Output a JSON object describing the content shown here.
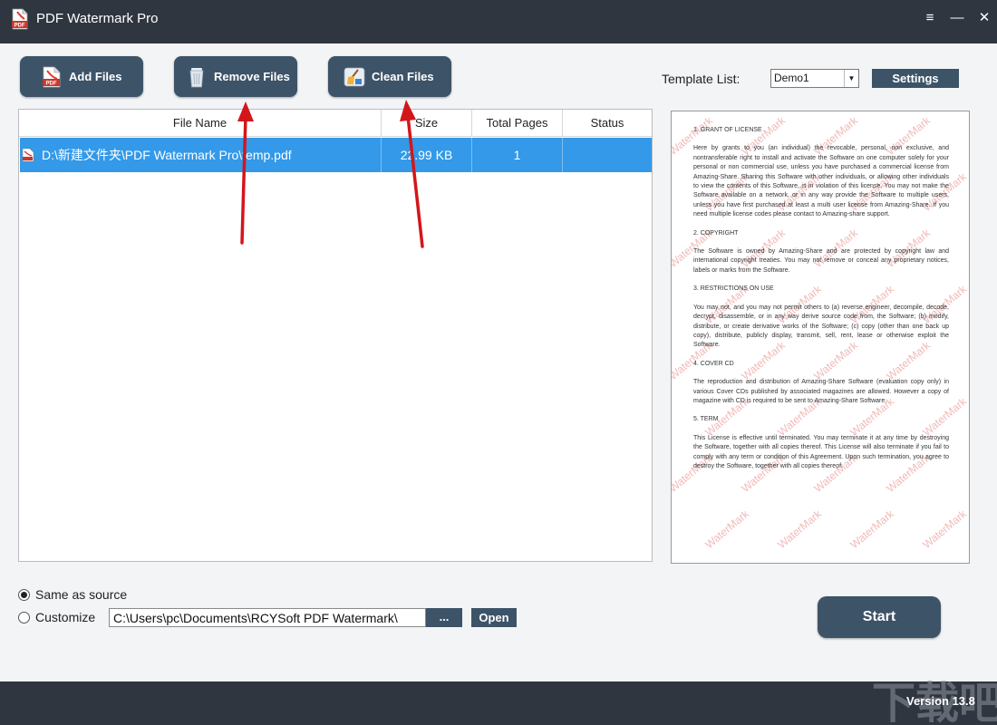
{
  "window": {
    "title": "PDF Watermark Pro",
    "app_icon_text": "PDF",
    "controls": {
      "menu": "≡",
      "minimize": "—",
      "close": "✕"
    }
  },
  "toolbar": {
    "add_files": "Add Files",
    "remove_files": "Remove Files",
    "clean_files": "Clean Files",
    "add_icon_text": "PDF"
  },
  "template": {
    "label": "Template List:",
    "selected": "Demo1",
    "settings_label": "Settings"
  },
  "table": {
    "columns": [
      "File Name",
      "Size",
      "Total Pages",
      "Status"
    ],
    "rows": [
      {
        "file_name": "D:\\新建文件夹\\PDF Watermark Pro\\temp.pdf",
        "size": "22.99 KB",
        "total_pages": "1",
        "status": ""
      }
    ]
  },
  "preview": {
    "watermark_text": "WaterMark",
    "sections": [
      {
        "heading": "1. GRANT OF LICENSE",
        "body": "Here by grants to you (an individual) the revocable, personal, non exclusive, and nontransferable right to install and activate the Software on one computer solely for your personal or non commercial use, unless you have purchased a commercial license from Amazing-Share. Sharing this Software with other individuals, or allowing other individuals to view the contents of this Software, is in violation of this license. You may not make the Software available on a network, or in any way provide the Software to multiple users, unless you have first purchased at least a multi user license from Amazing-Share. If you need multiple license codes please contact to Amazing-share support."
      },
      {
        "heading": "2. COPYRIGHT",
        "body": "The Software is owned by Amazing-Share and are protected by copyright law and international copyright treaties. You may not remove or conceal any proprietary notices, labels or marks from the Software."
      },
      {
        "heading": "3. RESTRICTIONS ON USE",
        "body": "You may not, and you may not permit others to (a) reverse engineer, decompile, decode, decrypt, disassemble, or in any way derive source code from, the Software; (b) modify, distribute, or create derivative works of the Software; (c) copy (other than one back up copy), distribute, publicly display, transmit, sell, rent, lease or otherwise exploit the Software."
      },
      {
        "heading": "4. COVER CD",
        "body": "The reproduction and distribution of Amazing-Share Software (evaluation copy only) in various Cover CDs published by associated magazines are allowed. However a copy of magazine with CD is required to be sent to Amazing-Share Software."
      },
      {
        "heading": "5. TERM",
        "body": "This License is effective until terminated. You may terminate it at any time by destroying the Software, together with all copies thereof. This License will also terminate if you fail to comply with any term or condition of this Agreement. Upon such termination, you agree to destroy the Software, together with all copies thereof."
      }
    ]
  },
  "output": {
    "same_as_source_label": "Same as source",
    "same_as_source_selected": true,
    "customize_label": "Customize",
    "customize_selected": false,
    "path_value": "C:\\Users\\pc\\Documents\\RCYSoft PDF Watermark\\",
    "browse_label": "...",
    "open_label": "Open"
  },
  "start_label": "Start",
  "footer": {
    "version": "Version 13.8",
    "site_mark_text": "下载吧"
  },
  "colors": {
    "titlebar": "#2f3640",
    "button": "#3d5368",
    "selection": "#3399e8",
    "watermark": "#f0b9b9",
    "arrow": "#d3161b"
  },
  "icons": {
    "app": "pdf-app-icon",
    "add": "pdf-file-icon",
    "remove": "trash-can-icon",
    "clean": "broom-icon",
    "row": "pdf-file-icon",
    "dropdown": "dropdown-arrow-icon"
  }
}
